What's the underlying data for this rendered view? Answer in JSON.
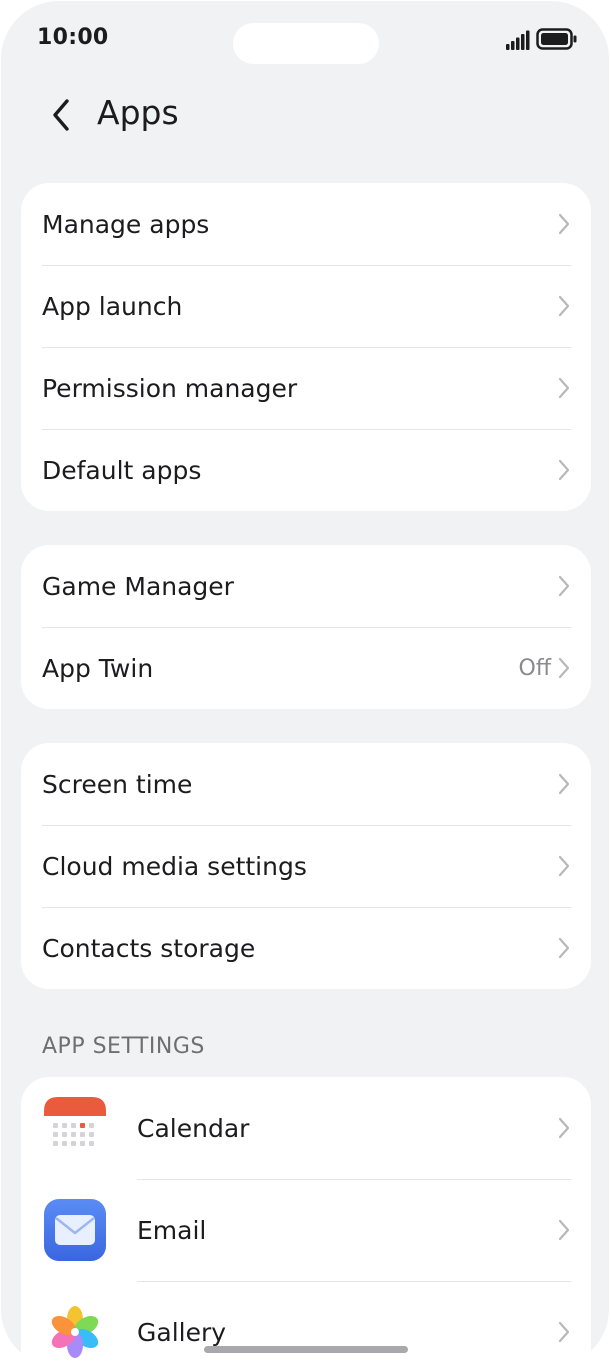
{
  "status_bar": {
    "time": "10:00",
    "icons": [
      "cellular-signal-icon",
      "battery-icon"
    ]
  },
  "header": {
    "title": "Apps",
    "back_icon": "back-arrow-icon"
  },
  "groups": [
    {
      "items": [
        {
          "label": "Manage apps"
        },
        {
          "label": "App launch"
        },
        {
          "label": "Permission manager"
        },
        {
          "label": "Default apps"
        }
      ]
    },
    {
      "items": [
        {
          "label": "Game Manager"
        },
        {
          "label": "App Twin",
          "value": "Off"
        }
      ]
    },
    {
      "items": [
        {
          "label": "Screen time"
        },
        {
          "label": "Cloud media settings"
        },
        {
          "label": "Contacts storage"
        }
      ]
    }
  ],
  "app_settings": {
    "header": "APP SETTINGS",
    "apps": [
      {
        "label": "Calendar",
        "icon": "calendar-icon"
      },
      {
        "label": "Email",
        "icon": "email-icon"
      },
      {
        "label": "Gallery",
        "icon": "gallery-icon"
      }
    ]
  },
  "colors": {
    "background": "#f1f2f4",
    "card": "#ffffff",
    "primary_text": "#1c1c1e",
    "secondary_text": "#8a8a8e",
    "chevron": "#b8b8bc"
  }
}
